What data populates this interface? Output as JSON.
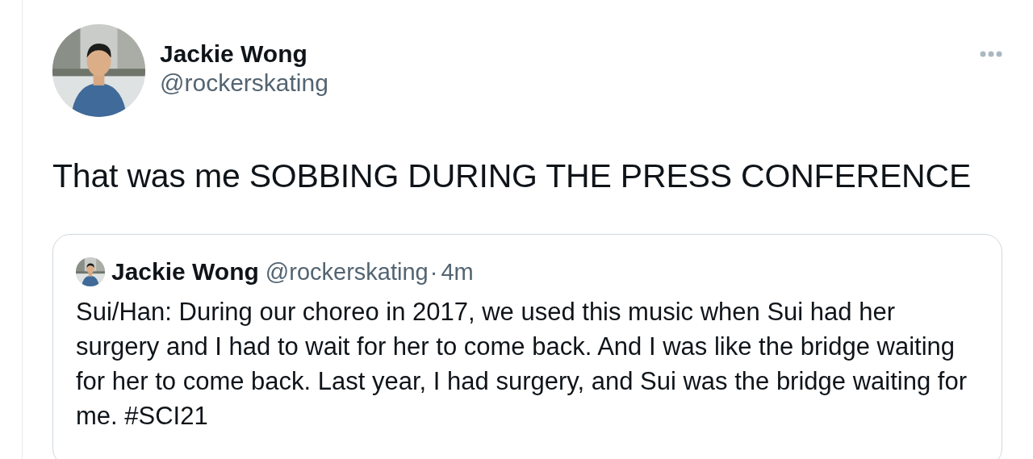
{
  "tweet": {
    "author": {
      "name": "Jackie Wong",
      "handle": "@rockerskating"
    },
    "text": "That was me SOBBING DURING THE PRESS CONFERENCE",
    "quoted": {
      "author": {
        "name": "Jackie Wong",
        "handle": "@rockerskating"
      },
      "separator": "·",
      "time": "4m",
      "text": "Sui/Han: During our choreo in 2017, we used this music when Sui had her surgery and I had to wait for her to come back. And I was like the bridge waiting for her to come back. Last year, I had surgery, and Sui was the bridge waiting for me. #SCI21"
    }
  }
}
